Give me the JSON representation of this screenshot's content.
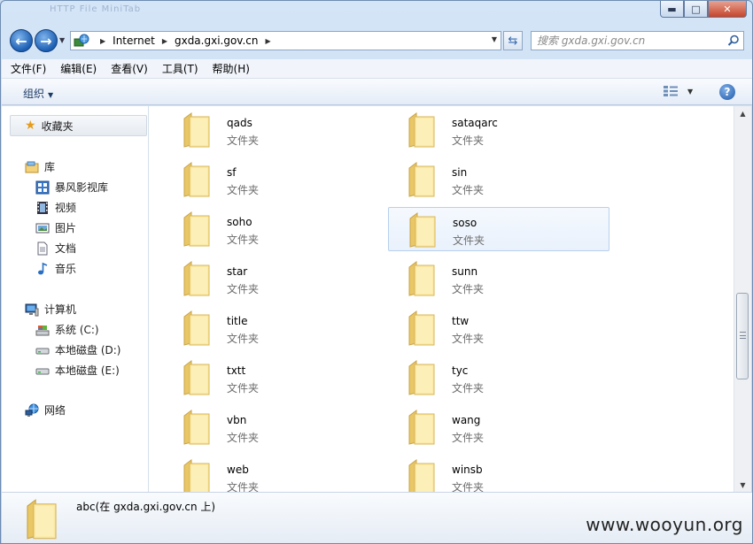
{
  "window": {
    "faint_title": "HTTP File    MiniTab",
    "controls": {
      "minimize": "▬",
      "maximize": "□",
      "close": "✕"
    }
  },
  "address_bar": {
    "crumbs": [
      "Internet",
      "gxda.gxi.gov.cn"
    ],
    "search_placeholder": "搜索 gxda.gxi.gov.cn"
  },
  "menubar": {
    "items": [
      "文件(F)",
      "编辑(E)",
      "查看(V)",
      "工具(T)",
      "帮助(H)"
    ]
  },
  "command_bar": {
    "organize": "组织",
    "help": "?"
  },
  "nav_pane": {
    "favorites": "收藏夹",
    "libraries": "库",
    "library_items": [
      "暴风影视库",
      "视频",
      "图片",
      "文档",
      "音乐"
    ],
    "computer": "计算机",
    "drives": [
      "系统 (C:)",
      "本地磁盘 (D:)",
      "本地磁盘 (E:)"
    ],
    "network": "网络"
  },
  "content": {
    "type_label": "文件夹",
    "left_column": [
      "qads",
      "sf",
      "soho",
      "star",
      "title",
      "txtt",
      "vbn",
      "web"
    ],
    "right_column": [
      "sataqarc",
      "sin",
      "soso",
      "sunn",
      "ttw",
      "tyc",
      "wang",
      "winsb"
    ],
    "selected": "soso"
  },
  "details_pane": {
    "text": "abc(在 gxda.gxi.gov.cn 上)"
  },
  "watermark": "www.wooyun.org",
  "colors": {
    "accent": "#1c5fb3",
    "folder_light": "#fbe9a4",
    "folder_dark": "#e6c35c",
    "selection": "#b8d0ee"
  }
}
